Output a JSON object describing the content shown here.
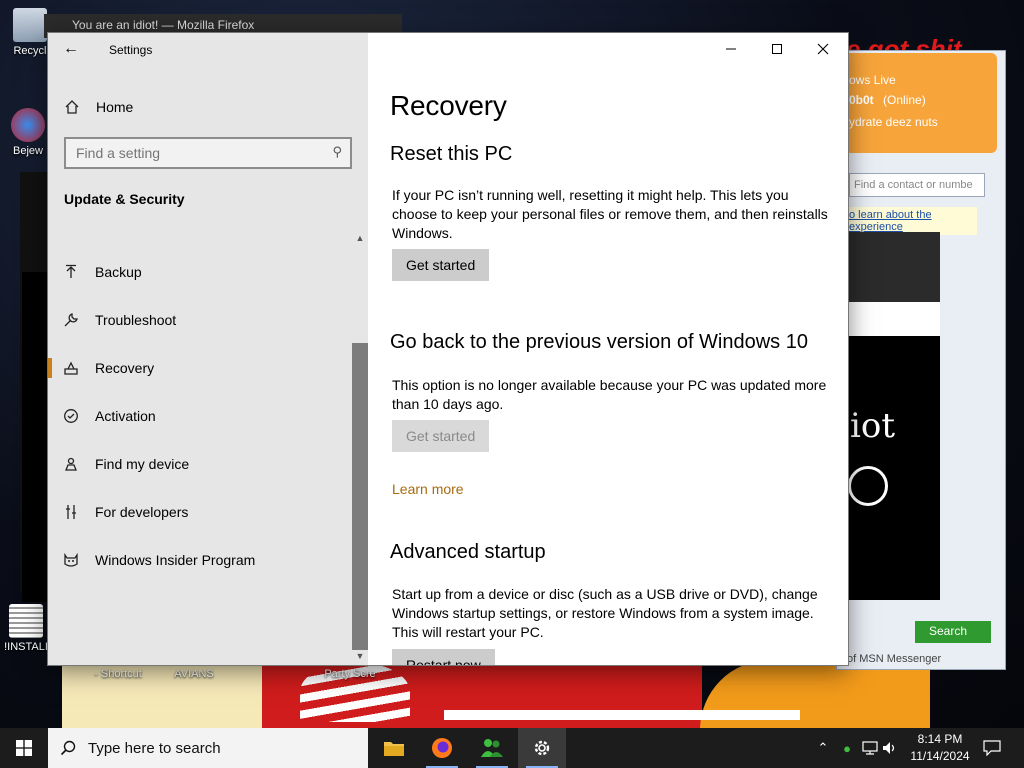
{
  "desktop": {
    "icons": [
      {
        "label": "Recycl"
      },
      {
        "label": "Bejew"
      },
      {
        "label": "!INSTALI"
      },
      {
        "label": "- Shortcut"
      },
      {
        "label": "AVIANS"
      },
      {
        "label": "Party Scre"
      }
    ],
    "bg_firefox_title": "You are an idiot! — Mozilla Firefox",
    "msn": {
      "status_line1": "ows Live",
      "status_name": "0b0t",
      "status_online": "(Online)",
      "status_msg": "ydrate deez nuts",
      "find_placeholder": "Find a contact or numbe",
      "link_text": "o learn about the experience",
      "search_label": "Search",
      "footer": "of MSN Messenger"
    },
    "idiot_text": "iot",
    "meme_text": "e got shit"
  },
  "settings": {
    "window_title": "Settings",
    "home_label": "Home",
    "search_placeholder": "Find a setting",
    "section_title": "Update & Security",
    "nav_items": [
      {
        "label": "Backup",
        "icon": "backup-icon"
      },
      {
        "label": "Troubleshoot",
        "icon": "wrench-icon"
      },
      {
        "label": "Recovery",
        "icon": "recovery-icon",
        "selected": true
      },
      {
        "label": "Activation",
        "icon": "check-circle-icon"
      },
      {
        "label": "Find my device",
        "icon": "person-locate-icon"
      },
      {
        "label": "For developers",
        "icon": "developer-icon"
      },
      {
        "label": "Windows Insider Program",
        "icon": "insider-cat-icon"
      }
    ],
    "page_title": "Recovery",
    "reset": {
      "heading": "Reset this PC",
      "text": "If your PC isn’t running well, resetting it might help. This lets you choose to keep your personal files or remove them, and then reinstalls Windows.",
      "button": "Get started"
    },
    "goback": {
      "heading": "Go back to the previous version of Windows 10",
      "text": "This option is no longer available because your PC was updated more than 10 days ago.",
      "button": "Get started",
      "link": "Learn more"
    },
    "advanced": {
      "heading": "Advanced startup",
      "text": "Start up from a device or disc (such as a USB drive or DVD), change Windows startup settings, or restore Windows from a system image. This will restart your PC.",
      "button": "Restart now"
    }
  },
  "taskbar": {
    "search_placeholder": "Type here to search",
    "time": "8:14 PM",
    "date": "11/14/2024",
    "apps": [
      "file-explorer-icon",
      "firefox-icon",
      "msn-messenger-icon",
      "settings-gear-icon"
    ]
  },
  "colors": {
    "accent": "#c8811d",
    "link": "#a76b10",
    "nav_bg": "#e6e6e6",
    "taskbar_bg": "#1c1c1c"
  }
}
